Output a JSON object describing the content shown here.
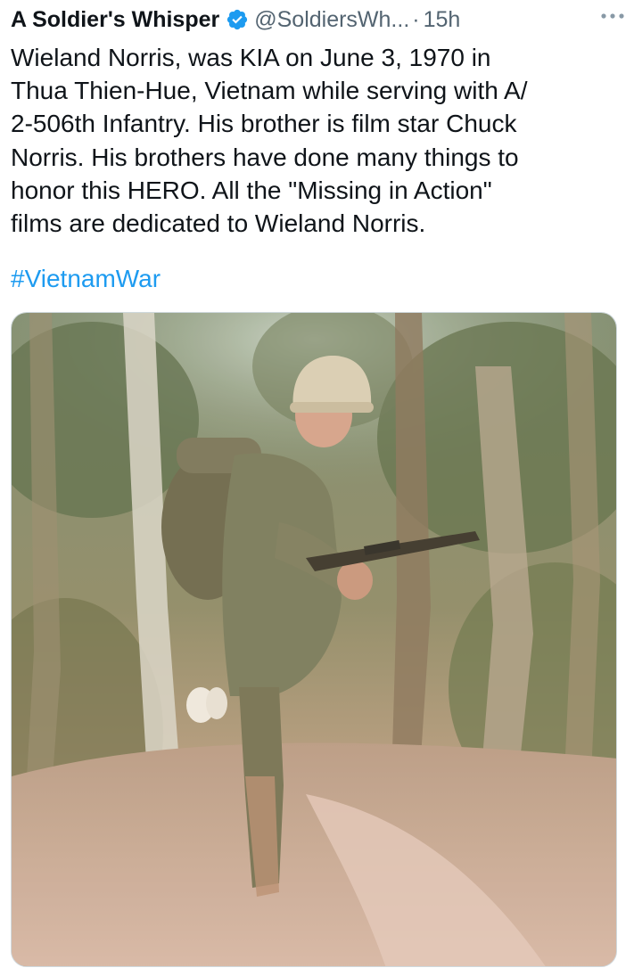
{
  "tweet": {
    "author": {
      "display_name": "A Soldier's Whisper",
      "verified_icon": "verified-badge-icon",
      "handle": "@SoldiersWh...",
      "separator": "·",
      "time": "15h"
    },
    "more_icon": "more-dots-icon",
    "text": "Wieland Norris, was KIA on June 3, 1970 in\nThua Thien-Hue, Vietnam while serving with A/\n2-506th Infantry. His brother is film star Chuck\nNorris. His brothers have done many things to\nhonor this HERO. All the \"Missing in Action\"\nfilms are dedicated to Wieland Norris.",
    "hashtag": "#VietnamWar",
    "media": {
      "type": "photo"
    }
  },
  "colors": {
    "text_primary": "#0f1419",
    "text_secondary": "#536471",
    "link": "#1d9bf0",
    "verified": "#1d9bf0"
  }
}
